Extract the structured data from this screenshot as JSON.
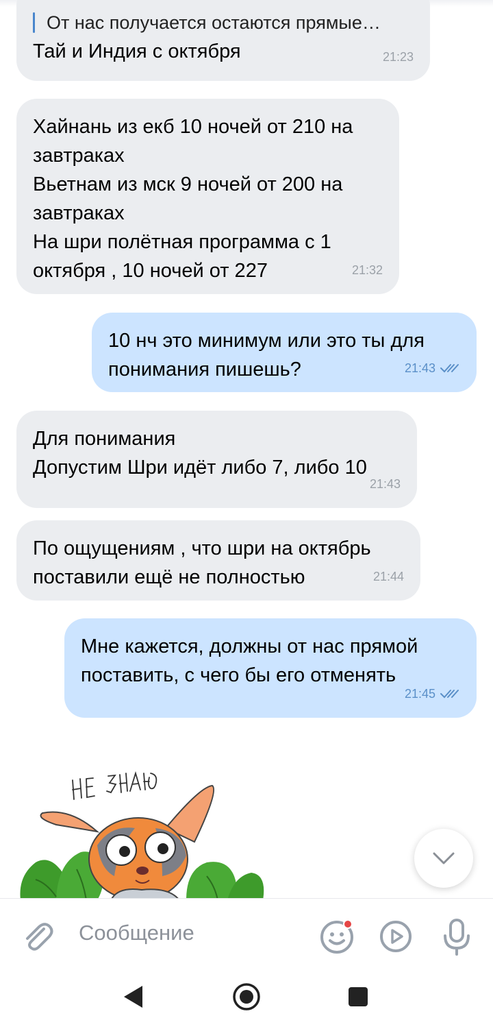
{
  "messages": [
    {
      "direction": "in",
      "reply_quote": "От нас получается остаются прямые…",
      "text": "Тай и Индия с октября",
      "time": "21:23"
    },
    {
      "direction": "in",
      "text": "Хайнань из екб 10 ночей от 210 на\nзавтраках\nВьетнам из мск 9 ночей от 200 на\nзавтраках\nНа шри полётная программа с 1\nоктября , 10 ночей от 227",
      "time": "21:32"
    },
    {
      "direction": "out",
      "text": "10 нч это минимум или это ты для\nпонимания пишешь?",
      "time": "21:43",
      "status": "read"
    },
    {
      "direction": "in",
      "text": "Для понимания\nДопустим Шри идёт либо 7, либо 10",
      "time": "21:43"
    },
    {
      "direction": "in",
      "text": "По ощущениям , что шри на октябрь\nпоставили ещё не полностью",
      "time": "21:44"
    },
    {
      "direction": "out",
      "text": "Мне кажется, должны от нас прямой\nпоставить, с чего бы его отменять",
      "time": "21:45",
      "status": "read"
    }
  ],
  "sticker": {
    "caption": "НЕ ЗНАЮ",
    "icon": "chihuahua-sticker"
  },
  "composer": {
    "placeholder": "Сообщение",
    "attach_icon": "paperclip-icon",
    "emoji_icon": "smile-icon",
    "emoji_badge_color": "#e64646",
    "video_icon": "video-message-icon",
    "mic_icon": "microphone-icon"
  },
  "navbar": {
    "back_icon": "back-triangle-icon",
    "home_icon": "home-circle-icon",
    "recent_icon": "recent-square-icon"
  },
  "colors": {
    "incoming_bubble": "#ebedf0",
    "outgoing_bubble": "#cce4ff",
    "accent": "#4986cc",
    "time_in": "#9ba1a8",
    "time_out": "#5a8fc8"
  }
}
